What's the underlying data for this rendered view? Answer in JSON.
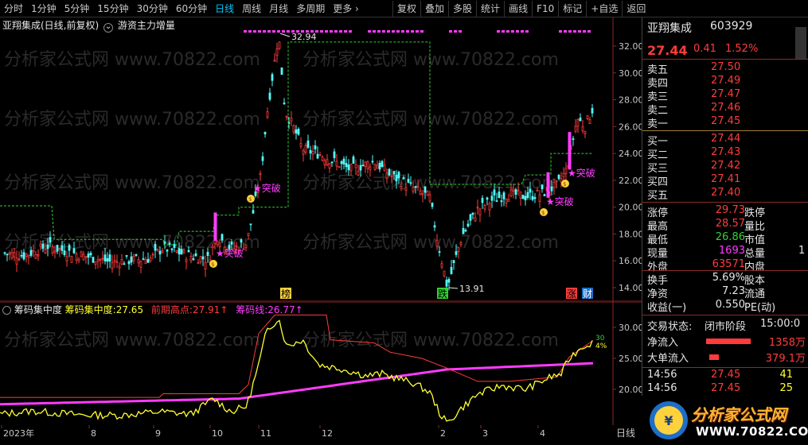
{
  "toolbar": {
    "periods": [
      "分时",
      "1分钟",
      "5分钟",
      "15分钟",
      "30分钟",
      "60分钟",
      "日线",
      "周线",
      "月线",
      "多周期",
      "更多"
    ],
    "active_period": "日线",
    "more_arrow": "›",
    "tools": [
      "复权",
      "叠加",
      "多股",
      "统计",
      "画线",
      "F10",
      "标记",
      "+自选",
      "返回"
    ]
  },
  "chart_header": {
    "title": "亚翔集成(日线,前复权)",
    "indicator_name": "游资主力增量",
    "dropdown_icon": "⌄"
  },
  "sub_header": {
    "name": "筹码集中度",
    "v1_label": "筹码集中度:",
    "v1": "27.65",
    "v2_label": "前期高点:",
    "v2": "27.91",
    "v2_arrow": "↑",
    "v3_label": "筹码线:",
    "v3": "26.77",
    "v3_arrow": "↑"
  },
  "main_axis": {
    "ticks": [
      "32.00",
      "30.00",
      "28.00",
      "26.00",
      "24.00",
      "22.00",
      "20.00",
      "18.00",
      "16.00",
      "14.00"
    ]
  },
  "sub_axis": {
    "ticks": [
      "30.00",
      "25.00",
      "20.00"
    ],
    "right_tag": "30",
    "right_tag2": "4%"
  },
  "annotations": {
    "high_label": "32.94",
    "low_label": "13.91",
    "breakthrough": "突破",
    "tags": [
      "榜",
      "跌",
      "涨",
      "财"
    ]
  },
  "x_axis": {
    "labels": [
      "2023年",
      "8",
      "9",
      "10",
      "11",
      "12",
      "2",
      "3",
      "4"
    ],
    "period": "日线"
  },
  "watermark": "分析家公式网 www.70822.com",
  "panel": {
    "name": "亚翔集成",
    "code": "603929",
    "price": "27.44",
    "change": "0.41",
    "change_pct": "1.52%",
    "asks": [
      {
        "label": "卖五",
        "price": "27.50"
      },
      {
        "label": "卖四",
        "price": "27.49"
      },
      {
        "label": "卖三",
        "price": "27.47"
      },
      {
        "label": "卖二",
        "price": "27.46"
      },
      {
        "label": "卖一",
        "price": "27.45"
      }
    ],
    "bids": [
      {
        "label": "买一",
        "price": "27.44"
      },
      {
        "label": "买二",
        "price": "27.43"
      },
      {
        "label": "买三",
        "price": "27.42"
      },
      {
        "label": "买四",
        "price": "27.41"
      },
      {
        "label": "买五",
        "price": "27.40"
      }
    ],
    "stats1": [
      {
        "l": "涨停",
        "v": "29.73",
        "r": "跌停"
      },
      {
        "l": "最高",
        "v": "28.57",
        "r": "量比"
      },
      {
        "l": "最低",
        "v": "26.86",
        "r": "市值"
      },
      {
        "l": "现量",
        "v": "1693",
        "r": "总量"
      },
      {
        "l": "外盘",
        "v": "63571",
        "r": "内盘"
      }
    ],
    "stats2": [
      {
        "l": "换手",
        "v": "5.69%",
        "r": "股本"
      },
      {
        "l": "净资",
        "v": "7.23",
        "r": "流通"
      },
      {
        "l": "收益(一)",
        "v": "0.550",
        "r": "PE(动)"
      }
    ],
    "trade_status_label": "交易状态:",
    "trade_status": "闭市阶段",
    "trade_time": "15:00:0",
    "net_inflow_label": "净流入",
    "net_inflow": "1358万",
    "big_inflow_label": "大单流入",
    "big_inflow": "379.1万",
    "ticks": [
      {
        "t": "14:56",
        "p": "27.45",
        "v": "41"
      },
      {
        "t": "14:56",
        "p": "27.45",
        "v": "25"
      }
    ],
    "r1": "1"
  },
  "logo": {
    "text": "分析家公式网",
    "url": "WWW.70822.COM"
  }
}
